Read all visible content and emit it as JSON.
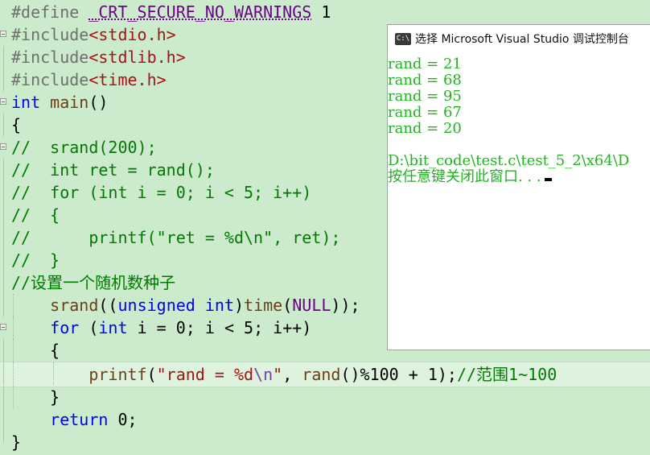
{
  "editor": {
    "lines": [
      {
        "k": "pp",
        "t": "#define _CRT_SECURE_NO_WARNINGS 1"
      },
      {
        "k": "inc",
        "t": "stdio.h"
      },
      {
        "k": "inc",
        "t": "stdlib.h"
      },
      {
        "k": "inc",
        "t": "time.h"
      },
      {
        "k": "code",
        "t": "int main()"
      },
      {
        "k": "code",
        "t": "{"
      },
      {
        "k": "cm",
        "t": "//  srand(200);"
      },
      {
        "k": "cm",
        "t": "//  int ret = rand();"
      },
      {
        "k": "cm",
        "t": "//  for (int i = 0; i < 5; i++)"
      },
      {
        "k": "cm",
        "t": "//  {"
      },
      {
        "k": "cm",
        "t": "//      printf(\"ret = %d\\n\", ret);"
      },
      {
        "k": "cm",
        "t": "//  }"
      },
      {
        "k": "cm",
        "t": "//设置一个随机数种子"
      },
      {
        "k": "code",
        "t": "    srand((unsigned int)time(NULL));"
      },
      {
        "k": "code",
        "t": "    for (int i = 0; i < 5; i++)"
      },
      {
        "k": "code",
        "t": "    {"
      },
      {
        "k": "code",
        "t": "        printf(\"rand = %d\\n\", rand()%100 + 1);//范围1~100"
      },
      {
        "k": "code",
        "t": "    }"
      },
      {
        "k": "code",
        "t": "    return 0;"
      },
      {
        "k": "code",
        "t": "}"
      }
    ],
    "include_prefix": "#include",
    "define_keyword": "#define",
    "define_macro": "_CRT_SECURE_NO_WARNINGS",
    "define_value": "1"
  },
  "console": {
    "title": "选择 Microsoft Visual Studio 调试控制台",
    "icon_label": "C:\\",
    "output_lines": [
      "rand = 21",
      "rand = 68",
      "rand = 95",
      "rand = 67",
      "rand = 20",
      "",
      "D:\\bit_code\\test.c\\test_5_2\\x64\\D",
      "按任意键关闭此窗口. . ."
    ]
  },
  "colors": {
    "editor_bg": "#cceacc",
    "keyword": "#0000ff",
    "string": "#a31515",
    "comment": "#007a00",
    "macro": "#6f008a",
    "console_text": "#22b322"
  }
}
